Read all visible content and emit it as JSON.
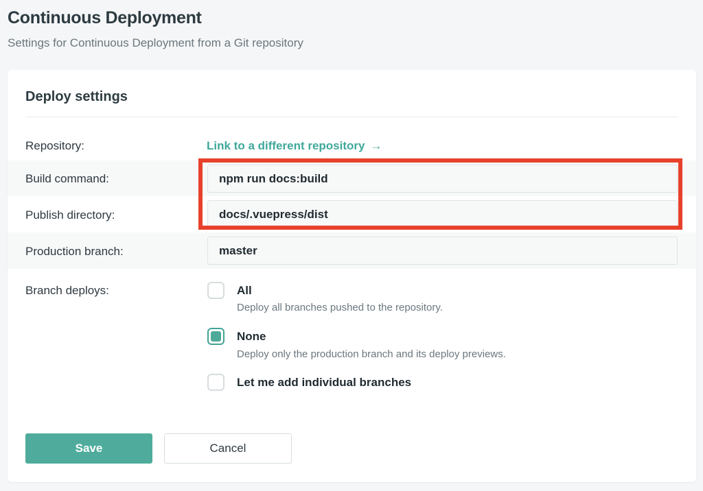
{
  "header": {
    "title": "Continuous Deployment",
    "subtitle": "Settings for Continuous Deployment from a Git repository"
  },
  "card": {
    "title": "Deploy settings",
    "repository": {
      "label": "Repository:",
      "link_text": "Link to a different repository",
      "arrow": "→"
    },
    "build_command": {
      "label": "Build command:",
      "value": "npm run docs:build"
    },
    "publish_directory": {
      "label": "Publish directory:",
      "value": "docs/.vuepress/dist"
    },
    "production_branch": {
      "label": "Production branch:",
      "value": "master"
    },
    "branch_deploys": {
      "label": "Branch deploys:",
      "options": [
        {
          "label": "All",
          "description": "Deploy all branches pushed to the repository.",
          "checked": false
        },
        {
          "label": "None",
          "description": "Deploy only the production branch and its deploy previews.",
          "checked": true
        },
        {
          "label": "Let me add individual branches",
          "description": "",
          "checked": false
        }
      ]
    },
    "buttons": {
      "save": "Save",
      "cancel": "Cancel"
    }
  },
  "colors": {
    "accent": "#4fac9c",
    "highlight": "#e8412b"
  }
}
